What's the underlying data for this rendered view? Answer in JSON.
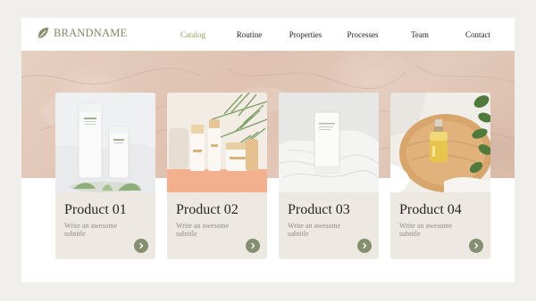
{
  "brand": {
    "name": "BRANDNAME",
    "icon": "leaf-icon",
    "color": "#7f8b67"
  },
  "nav": {
    "items": [
      {
        "label": "Catalog",
        "active": true
      },
      {
        "label": "Routine"
      },
      {
        "label": "Properties"
      },
      {
        "label": "Processes"
      },
      {
        "label": "Team"
      },
      {
        "label": "Contact"
      }
    ],
    "active_color": "#90a35c"
  },
  "products": [
    {
      "title": "Product 01",
      "subtitle": "Write an awesome subtitle",
      "image": "two white cream tubes on marble",
      "action_icon": "chevron-right-icon"
    },
    {
      "title": "Product 02",
      "subtitle": "Write an awesome subtitle",
      "image": "serum bottles with palm leaf on peach backdrop",
      "action_icon": "chevron-right-icon"
    },
    {
      "title": "Product 03",
      "subtitle": "Write an awesome subtitle",
      "image": "white tube on white fabric",
      "action_icon": "chevron-right-icon"
    },
    {
      "title": "Product 04",
      "subtitle": "Write an awesome subtitle",
      "image": "dropper oil bottle on wooden tray with leaves",
      "action_icon": "chevron-right-icon"
    }
  ],
  "colors": {
    "card_bg": "#ede9e2",
    "button": "#858e6e",
    "page_bg": "#f1efeb"
  }
}
